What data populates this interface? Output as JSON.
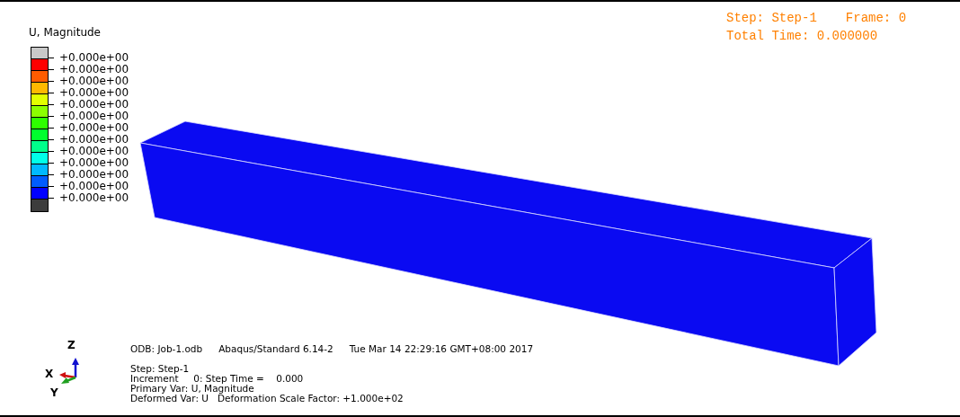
{
  "status_header": {
    "step": "Step: Step-1",
    "frame": "Frame: 0",
    "total_time": "Total Time: 0.000000"
  },
  "legend": {
    "title": "U, Magnitude",
    "bands": [
      {
        "color": "#c8c8c8"
      },
      {
        "color": "#ff0000"
      },
      {
        "color": "#ff5c00"
      },
      {
        "color": "#ffb900"
      },
      {
        "color": "#e3ff00"
      },
      {
        "color": "#8cff00"
      },
      {
        "color": "#2eff00"
      },
      {
        "color": "#00ff2e"
      },
      {
        "color": "#00ff8b"
      },
      {
        "color": "#00ffe8"
      },
      {
        "color": "#00b9ff"
      },
      {
        "color": "#005cff"
      },
      {
        "color": "#0000ff"
      },
      {
        "color": "#3c3c3c"
      }
    ],
    "labels": [
      "+0.000e+00",
      "+0.000e+00",
      "+0.000e+00",
      "+0.000e+00",
      "+0.000e+00",
      "+0.000e+00",
      "+0.000e+00",
      "+0.000e+00",
      "+0.000e+00",
      "+0.000e+00",
      "+0.000e+00",
      "+0.000e+00",
      "+0.000e+00"
    ]
  },
  "triad": {
    "z": "Z",
    "x": "X",
    "y": "Y"
  },
  "info": {
    "odb": "ODB: Job-1.odb",
    "solver": "Abaqus/Standard 6.14-2",
    "date": "Tue Mar 14 22:29:16 GMT+08:00 2017",
    "lines": [
      "Step: Step-1",
      "Increment     0: Step Time =    0.000",
      "Primary Var: U, Magnitude",
      "Deformed Var: U   Deformation Scale Factor: +1.000e+02"
    ]
  }
}
